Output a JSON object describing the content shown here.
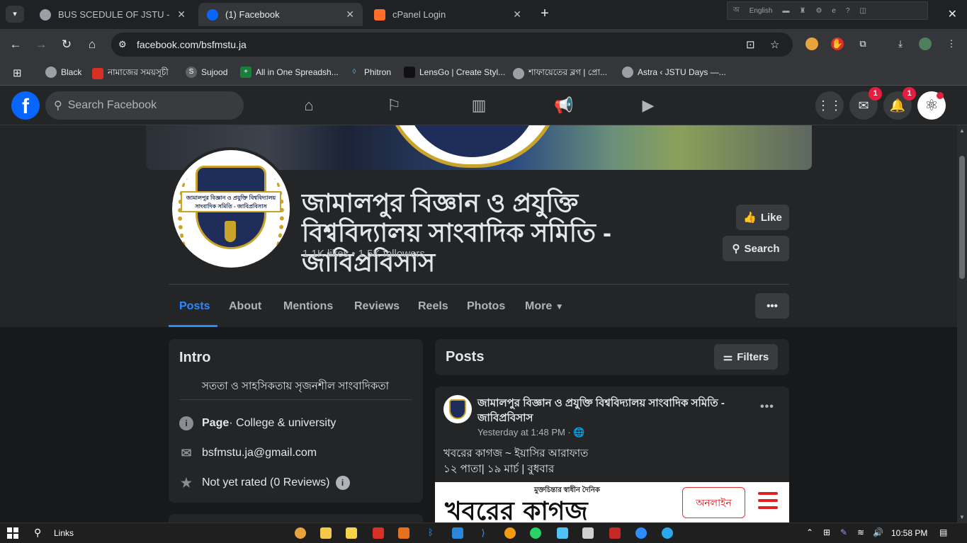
{
  "browser": {
    "tabs": [
      {
        "title": "BUS SCEDULE OF JSTU - Love M",
        "active": false,
        "favicon_color": "#9aa0a6"
      },
      {
        "title": "(1) Facebook",
        "active": true,
        "favicon_color": "#0866ff"
      },
      {
        "title": "cPanel Login",
        "active": false,
        "favicon_color": "#ff6c2c"
      }
    ],
    "ime_label": "English",
    "url": "facebook.com/bsfmstu.ja",
    "bookmarks": [
      {
        "label": "Black",
        "color": "#9aa0a6"
      },
      {
        "label": "নামাজের সময়সূচী",
        "color": "#d93025"
      },
      {
        "label": "Sujood",
        "color": "#5f6368"
      },
      {
        "label": "All in One Spreadsh...",
        "color": "#188038"
      },
      {
        "label": "Phitron",
        "color": "#4fc3f7"
      },
      {
        "label": "LensGo | Create Styl...",
        "color": "#111111"
      },
      {
        "label": "শাফায়েতের ব্লগ | প্রো...",
        "color": "#9aa0a6"
      },
      {
        "label": "Astra ‹ JSTU Days —...",
        "color": "#9aa0a6"
      }
    ]
  },
  "fb_header": {
    "search_placeholder": "Search Facebook",
    "messenger_badge": "1",
    "notifications_badge": "1"
  },
  "page": {
    "name": "জামালপুর বিজ্ঞান ও প্রযুক্তি বিশ্ববিদ্যালয় সাংবাদিক সমিতি - জাবিপ্রবিসাস",
    "stats": "1.1K likes • 1.5K followers",
    "like_label": "Like",
    "search_label": "Search",
    "tabs": [
      "Posts",
      "About",
      "Mentions",
      "Reviews",
      "Reels",
      "Photos",
      "More"
    ],
    "logo_band_text": "জামালপুর বিজ্ঞান ও প্রযুক্তি বিশ্ববিদ্যালয় সাংবাদিক সমিতি - জাবিপ্রবিসাস"
  },
  "intro": {
    "title": "Intro",
    "bio": "সততা ও সাহসিকতায় সৃজনশীল সাংবাদিকতা",
    "category_bold": "Page",
    "category_rest": " · College & university",
    "email": "bsfmstu.ja@gmail.com",
    "rating": "Not yet rated (0 Reviews)"
  },
  "posts": {
    "title": "Posts",
    "filters_label": "Filters",
    "post": {
      "author": "জামালপুর বিজ্ঞান ও প্রযুক্তি বিশ্ববিদ্যালয় সাংবাদিক সমিতি - জাবিপ্রবিসাস",
      "time": "Yesterday at 1:48 PM · ",
      "line1": "খবরের কাগজ ~ ইয়াসির আরাফাত",
      "line2": "১২ পাতা| ১৯ মার্চ | বুধবার",
      "image_tag": "মুক্তচিন্তার স্বাধীন দৈনিক",
      "image_headline": "খবরের কাগজ",
      "image_button": "অনলাইন"
    }
  },
  "taskbar": {
    "links_label": "Links",
    "time": "10:58 PM"
  }
}
